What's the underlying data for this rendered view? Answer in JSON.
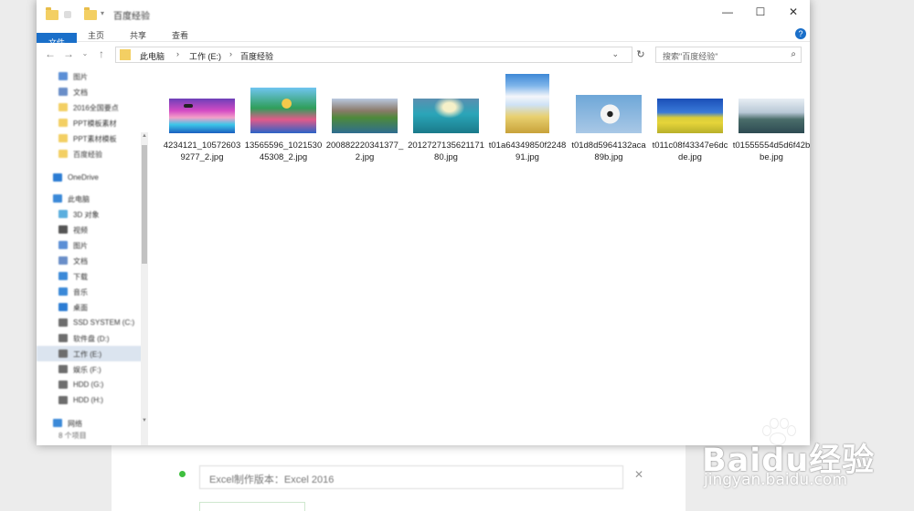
{
  "window": {
    "title": "百度经验",
    "controls": {
      "minimize": "—",
      "maximize": "☐",
      "close": "✕"
    }
  },
  "ribbon": {
    "tabs": [
      "文件",
      "主页",
      "共享",
      "查看"
    ],
    "help": "?"
  },
  "address": {
    "crumbs": [
      "此电脑",
      "工作 (E:)",
      "百度经验"
    ],
    "separator": "›",
    "dropdown": "⌄",
    "refresh": "↻"
  },
  "search": {
    "placeholder": "搜索\"百度经验\"",
    "icon": "search-icon"
  },
  "sidebar": {
    "items": [
      {
        "label": "图片",
        "icon": "pictures-icon",
        "color": "#5b8fd6"
      },
      {
        "label": "文档",
        "icon": "documents-icon",
        "color": "#6a8ec8"
      },
      {
        "label": "2016全国要点",
        "icon": "folder-icon",
        "color": "#f3cf63"
      },
      {
        "label": "PPT模板素材",
        "icon": "folder-icon",
        "color": "#f3cf63"
      },
      {
        "label": "PPT素材模板",
        "icon": "folder-icon",
        "color": "#f3cf63"
      },
      {
        "label": "百度经验",
        "icon": "folder-icon",
        "color": "#f3cf63"
      },
      {
        "label": "OneDrive",
        "icon": "cloud-icon",
        "color": "#2b7cd3"
      },
      {
        "label": "此电脑",
        "icon": "computer-icon",
        "color": "#3b89d8"
      },
      {
        "label": "3D 对象",
        "icon": "objects3d-icon",
        "color": "#5aaede"
      },
      {
        "label": "视频",
        "icon": "videos-icon",
        "color": "#555555"
      },
      {
        "label": "图片",
        "icon": "pictures-icon",
        "color": "#5b8fd6"
      },
      {
        "label": "文档",
        "icon": "documents-icon",
        "color": "#6a8ec8"
      },
      {
        "label": "下载",
        "icon": "downloads-icon",
        "color": "#3b89d8"
      },
      {
        "label": "音乐",
        "icon": "music-icon",
        "color": "#3b89d8"
      },
      {
        "label": "桌面",
        "icon": "desktop-icon",
        "color": "#2b7cd3"
      },
      {
        "label": "SSD SYSTEM (C:)",
        "icon": "drive-icon",
        "color": "#6d6d6d"
      },
      {
        "label": "软件盘 (D:)",
        "icon": "drive-icon",
        "color": "#6d6d6d"
      },
      {
        "label": "工作 (E:)",
        "icon": "drive-icon",
        "color": "#6d6d6d"
      },
      {
        "label": "娱乐 (F:)",
        "icon": "drive-icon",
        "color": "#6d6d6d"
      },
      {
        "label": "HDD (G:)",
        "icon": "drive-icon",
        "color": "#6d6d6d"
      },
      {
        "label": "HDD (H:)",
        "icon": "drive-icon",
        "color": "#6d6d6d"
      },
      {
        "label": "网络",
        "icon": "network-icon",
        "color": "#3b89d8"
      }
    ]
  },
  "status": {
    "count": "8 个项目"
  },
  "files": [
    {
      "name": "4234121_105726039277_2.jpg",
      "thumb": "t1"
    },
    {
      "name": "13565596_102153045308_2.jpg",
      "thumb": "t2"
    },
    {
      "name": "200882220341377_2.jpg",
      "thumb": "t3"
    },
    {
      "name": "201272713562117180.jpg",
      "thumb": "t4"
    },
    {
      "name": "t01a64349850f224891.jpg",
      "thumb": "t5"
    },
    {
      "name": "t01d8d5964132aca89b.jpg",
      "thumb": "t6"
    },
    {
      "name": "t011c08f43347e6dcde.jpg",
      "thumb": "t7"
    },
    {
      "name": "t01555554d5d6f42bbe.jpg",
      "thumb": "t8"
    }
  ],
  "background": {
    "field_text": "Excel制作版本：Excel 2016",
    "close": "✕"
  },
  "watermark": {
    "brand": "Baidu经验",
    "url": "jingyan.baidu.com"
  }
}
